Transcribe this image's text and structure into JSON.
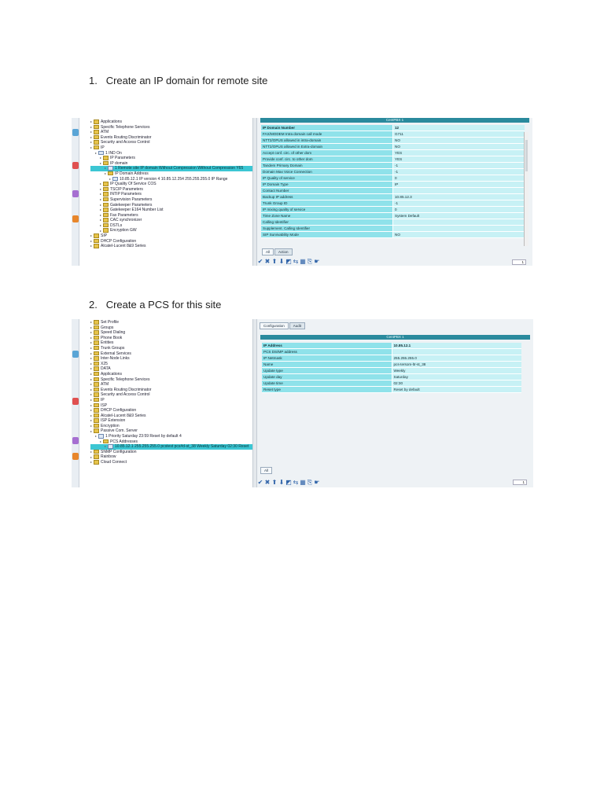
{
  "steps": [
    {
      "number": "1.",
      "text": "Create an IP domain for remote site"
    },
    {
      "number": "2.",
      "text": "Create a PCS for this site"
    }
  ],
  "shot1": {
    "tree": [
      {
        "label": "Applications",
        "indent": 0,
        "icon": "folder"
      },
      {
        "label": "Specific Telephone Services",
        "indent": 0,
        "icon": "folder"
      },
      {
        "label": "ATM",
        "indent": 0,
        "icon": "folder"
      },
      {
        "label": "Events Routing Discriminator",
        "indent": 0,
        "icon": "folder"
      },
      {
        "label": "Security and Access Control",
        "indent": 0,
        "icon": "folder"
      },
      {
        "label": "IP",
        "indent": 0,
        "icon": "folder"
      },
      {
        "label": "1 IND On",
        "indent": 1,
        "icon": "doc"
      },
      {
        "label": "IP Parameters",
        "indent": 2,
        "icon": "folder"
      },
      {
        "label": "IP domain",
        "indent": 2,
        "icon": "folder"
      },
      {
        "label": "1 Remote site IP domain Without Compression Without Compression Y65",
        "indent": 3,
        "icon": "doc",
        "selected": true
      },
      {
        "label": "IP Domain Address",
        "indent": 3,
        "icon": "folder"
      },
      {
        "label": "10.85.12.1 IP version 4 10.85.12.254 255.255.255.0 IP Range",
        "indent": 4,
        "icon": "doc"
      },
      {
        "label": "IP Quality Of Service COS",
        "indent": 2,
        "icon": "folder"
      },
      {
        "label": "TSCIP Parameters",
        "indent": 2,
        "icon": "folder"
      },
      {
        "label": "INTIP Parameters",
        "indent": 2,
        "icon": "folder"
      },
      {
        "label": "Supervision Parameters",
        "indent": 2,
        "icon": "folder"
      },
      {
        "label": "Gatekeeper Parameters",
        "indent": 2,
        "icon": "folder"
      },
      {
        "label": "Gatekeeper E164 Number List",
        "indent": 2,
        "icon": "folder"
      },
      {
        "label": "Fax Parameters",
        "indent": 2,
        "icon": "folder"
      },
      {
        "label": "CAC synchronizer",
        "indent": 2,
        "icon": "folder"
      },
      {
        "label": "DSTLs",
        "indent": 2,
        "icon": "folder"
      },
      {
        "label": "Encryption GW",
        "indent": 2,
        "icon": "folder"
      },
      {
        "label": "SIP",
        "indent": 0,
        "icon": "folder"
      },
      {
        "label": "DHCP Configuration",
        "indent": 0,
        "icon": "folder"
      },
      {
        "label": "Alcatel-Lucent 8&9 Series",
        "indent": 0,
        "icon": "folder"
      }
    ],
    "title": "CentPBX 1",
    "props": [
      {
        "k": "IP Domain Number",
        "v": "12",
        "hdr": true
      },
      {
        "k": "FAX/MODEM Intra domain call mode",
        "v": "G711"
      },
      {
        "k": "NTT2/OPUS allowed in intra-domain",
        "v": "NO"
      },
      {
        "k": "NTT2/OPUS allowed in Extra-domain",
        "v": "NO"
      },
      {
        "k": "Accept conf. circ. of other dom",
        "v": "YES"
      },
      {
        "k": "Provide conf. circ. to other dom",
        "v": "YES"
      },
      {
        "k": "Tandem Primary Domain",
        "v": "-1"
      },
      {
        "k": "Domain Max Voice Connection",
        "v": "-1"
      },
      {
        "k": "IP Quality of service",
        "v": "0"
      },
      {
        "k": "IP Domain Type",
        "v": "IP"
      },
      {
        "k": "Contact Number",
        "v": ""
      },
      {
        "k": "Backup IP address",
        "v": "10.85.12.3"
      },
      {
        "k": "Trunk Group ID",
        "v": "-1"
      },
      {
        "k": "IP mixing quality of service",
        "v": "0"
      },
      {
        "k": "Time Zone Name",
        "v": "System Default"
      },
      {
        "k": "Calling Identifier",
        "v": ""
      },
      {
        "k": "Supplement. Calling Identifier",
        "v": ""
      },
      {
        "k": "SIP Survivability Mode",
        "v": "NO"
      }
    ],
    "tabs": [
      "All",
      "Action"
    ],
    "toolbar": [
      "✔",
      "✖",
      "⬆",
      "⬇",
      "◩",
      "⇆",
      "▦",
      "⎘",
      "☛"
    ],
    "page": "1"
  },
  "shot2": {
    "tree": [
      {
        "label": "Set Profile",
        "indent": 0,
        "icon": "folder"
      },
      {
        "label": "Groups",
        "indent": 0,
        "icon": "folder"
      },
      {
        "label": "Speed Dialing",
        "indent": 0,
        "icon": "folder"
      },
      {
        "label": "Phone Book",
        "indent": 0,
        "icon": "folder"
      },
      {
        "label": "Entities",
        "indent": 0,
        "icon": "folder"
      },
      {
        "label": "Trunk Groups",
        "indent": 0,
        "icon": "folder"
      },
      {
        "label": "External Services",
        "indent": 0,
        "icon": "folder"
      },
      {
        "label": "Inter-Node Links",
        "indent": 0,
        "icon": "folder"
      },
      {
        "label": "X25",
        "indent": 0,
        "icon": "folder"
      },
      {
        "label": "DATA",
        "indent": 0,
        "icon": "folder"
      },
      {
        "label": "Applications",
        "indent": 0,
        "icon": "folder"
      },
      {
        "label": "Specific Telephone Services",
        "indent": 0,
        "icon": "folder"
      },
      {
        "label": "ATM",
        "indent": 0,
        "icon": "folder"
      },
      {
        "label": "Events Routing Discriminator",
        "indent": 0,
        "icon": "folder"
      },
      {
        "label": "Security and Access Control",
        "indent": 0,
        "icon": "folder"
      },
      {
        "label": "IP",
        "indent": 0,
        "icon": "folder"
      },
      {
        "label": "ISP",
        "indent": 0,
        "icon": "folder"
      },
      {
        "label": "DHCP Configuration",
        "indent": 0,
        "icon": "folder"
      },
      {
        "label": "Alcatel-Lucent 8&9 Series",
        "indent": 0,
        "icon": "folder"
      },
      {
        "label": "ISP Extension",
        "indent": 0,
        "icon": "folder"
      },
      {
        "label": "Encryption",
        "indent": 0,
        "icon": "folder"
      },
      {
        "label": "Passive Com. Server",
        "indent": 0,
        "icon": "folder"
      },
      {
        "label": "1 Priority Saturday 23:59 Reset by default 4",
        "indent": 1,
        "icon": "doc"
      },
      {
        "label": "PCS Addresses",
        "indent": 2,
        "icon": "folder"
      },
      {
        "label": "10.85.12.1 255.255.255.0 pcstest pcs#d-st_38 Weekly Saturday 02:30 Reset",
        "indent": 3,
        "icon": "doc",
        "selected": true
      },
      {
        "label": "SNMP Configuration",
        "indent": 0,
        "icon": "folder"
      },
      {
        "label": "Rainbow",
        "indent": 0,
        "icon": "folder"
      },
      {
        "label": "Cloud Connect",
        "indent": 0,
        "icon": "folder"
      }
    ],
    "tabs": [
      "Configuration",
      "Audit"
    ],
    "title": "CentPBX 1",
    "props": [
      {
        "k": "IP Address",
        "v": "10.85.12.1",
        "hdr": true
      },
      {
        "k": "PCS DS/MP address",
        "v": ""
      },
      {
        "k": "IP Netmask",
        "v": "255.255.255.0"
      },
      {
        "k": "Name",
        "v": "pcs-tersom-ltr-st_38"
      },
      {
        "k": "Update type",
        "v": "Weekly"
      },
      {
        "k": "Update day",
        "v": "Saturday"
      },
      {
        "k": "Update time",
        "v": "02:30"
      },
      {
        "k": "Reset type",
        "v": "Reset by default"
      }
    ],
    "bottom_tabs": [
      "All"
    ],
    "toolbar": [
      "✔",
      "✖",
      "⬆",
      "⬇",
      "◩",
      "⇆",
      "▦",
      "⎘",
      "☛"
    ],
    "page": "1"
  }
}
